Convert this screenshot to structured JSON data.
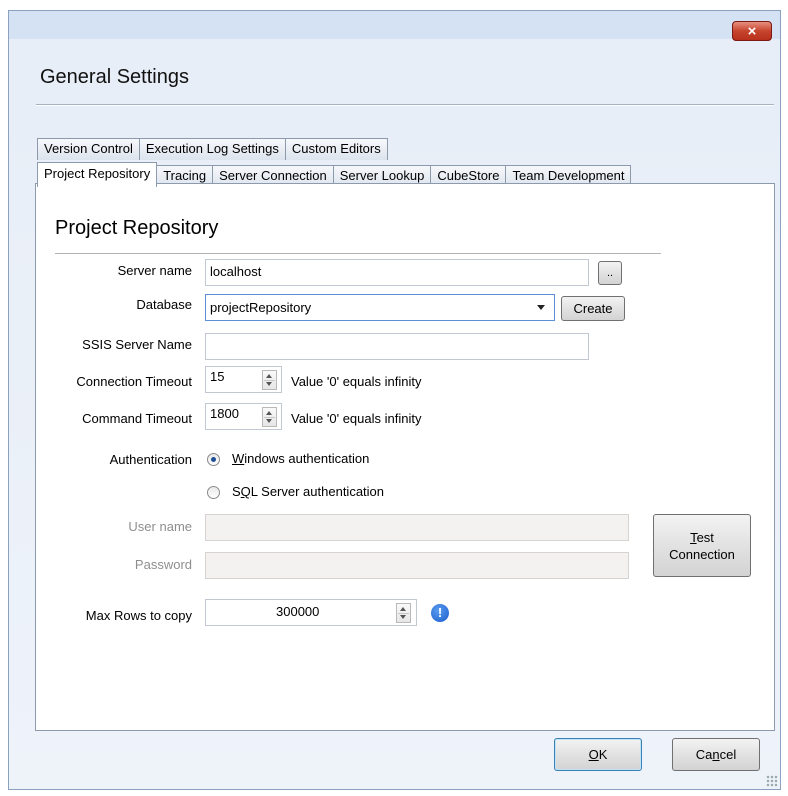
{
  "dialog": {
    "heading": "General Settings",
    "close_glyph": "×"
  },
  "tabs": {
    "row1": [
      "Version Control",
      "Execution Log Settings",
      "Custom Editors"
    ],
    "row2": [
      "Project Repository",
      "Tracing",
      "Server Connection",
      "Server Lookup",
      "CubeStore",
      "Team Development"
    ],
    "active": "Project Repository"
  },
  "panel": {
    "title": "Project Repository",
    "server_name": {
      "label": "Server name",
      "value": "localhost",
      "browse_label": ".."
    },
    "database": {
      "label": "Database",
      "value": "projectRepository",
      "create_label": "Create"
    },
    "ssis_server_name": {
      "label": "SSIS Server Name",
      "value": ""
    },
    "connection_timeout": {
      "label": "Connection Timeout",
      "value": "15",
      "hint": "Value '0' equals infinity"
    },
    "command_timeout": {
      "label": "Command Timeout",
      "value": "1800",
      "hint": "Value '0' equals infinity"
    },
    "authentication": {
      "label": "Authentication",
      "windows_prefix": "W",
      "windows_rest": "indows authentication",
      "sql_prefix": "S",
      "sql_mid": "Q",
      "sql_rest": "L Server authentication",
      "selected": "windows"
    },
    "user_name": {
      "label": "User name",
      "value": ""
    },
    "password": {
      "label": "Password",
      "value": ""
    },
    "test_connection": {
      "line1_prefix": "T",
      "line1_rest": "est",
      "line2": "Connection"
    },
    "max_rows": {
      "label": "Max Rows to copy",
      "value": "300000",
      "info_glyph": "!"
    }
  },
  "footer": {
    "ok_prefix": "O",
    "ok_rest": "K",
    "cancel_prefix": "Ca",
    "cancel_mid": "n",
    "cancel_rest": "cel"
  },
  "colors": {
    "title_bar": "#d4e2f3",
    "close_button": "#c7442d",
    "focus_border": "#5b8fd6",
    "info_icon": "#1b5ccc"
  },
  "icons": [
    "close-icon",
    "dropdown-caret-icon",
    "spinner-up-icon",
    "spinner-down-icon",
    "info-icon",
    "resize-grip-icon"
  ]
}
